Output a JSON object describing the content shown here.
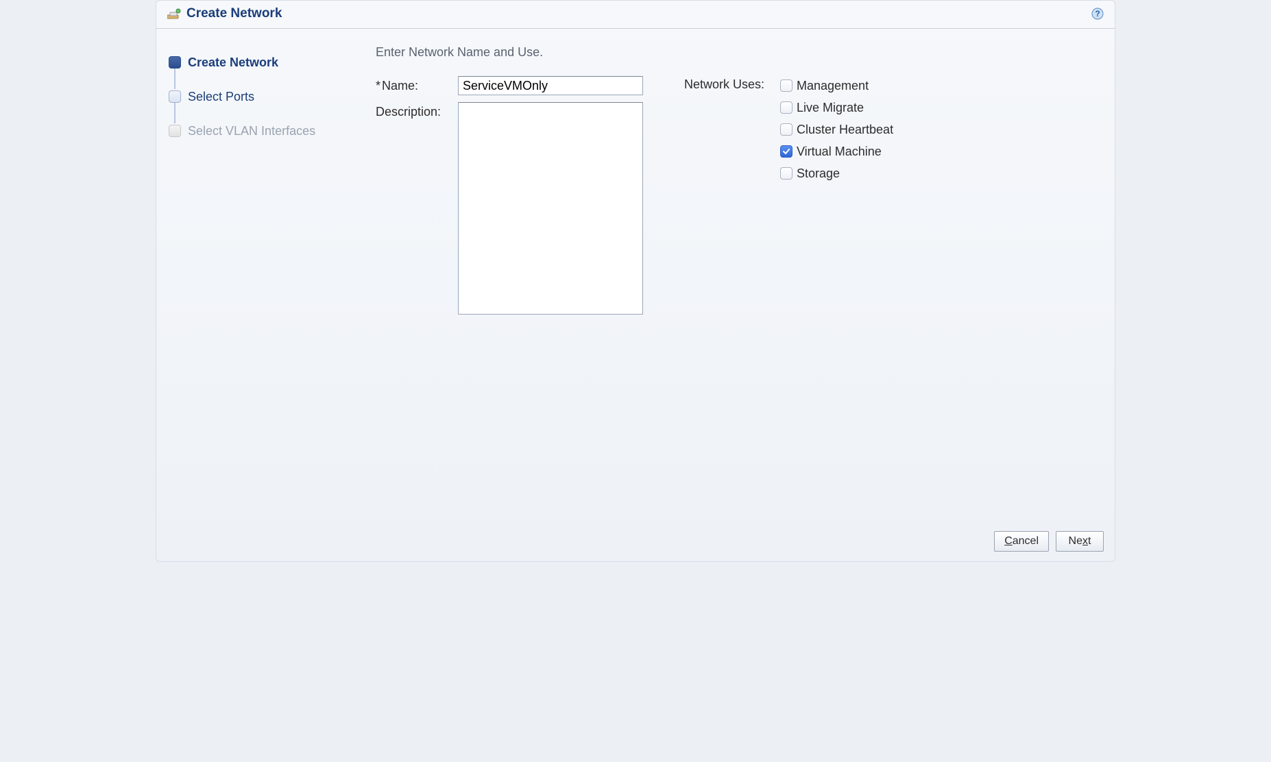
{
  "header": {
    "title": "Create Network"
  },
  "steps": [
    {
      "label": "Create Network",
      "state": "active"
    },
    {
      "label": "Select Ports",
      "state": "available"
    },
    {
      "label": "Select VLAN Interfaces",
      "state": "disabled"
    }
  ],
  "content": {
    "instruction": "Enter Network Name and Use.",
    "name_label": "Name:",
    "required_marker": "*",
    "name_value": "ServiceVMOnly",
    "description_label": "Description:",
    "description_value": "",
    "uses_label": "Network Uses:",
    "uses": [
      {
        "label": "Management",
        "checked": false
      },
      {
        "label": "Live Migrate",
        "checked": false
      },
      {
        "label": "Cluster Heartbeat",
        "checked": false
      },
      {
        "label": "Virtual Machine",
        "checked": true
      },
      {
        "label": "Storage",
        "checked": false
      }
    ]
  },
  "footer": {
    "cancel_label": "Cancel",
    "next_label": "Next"
  }
}
